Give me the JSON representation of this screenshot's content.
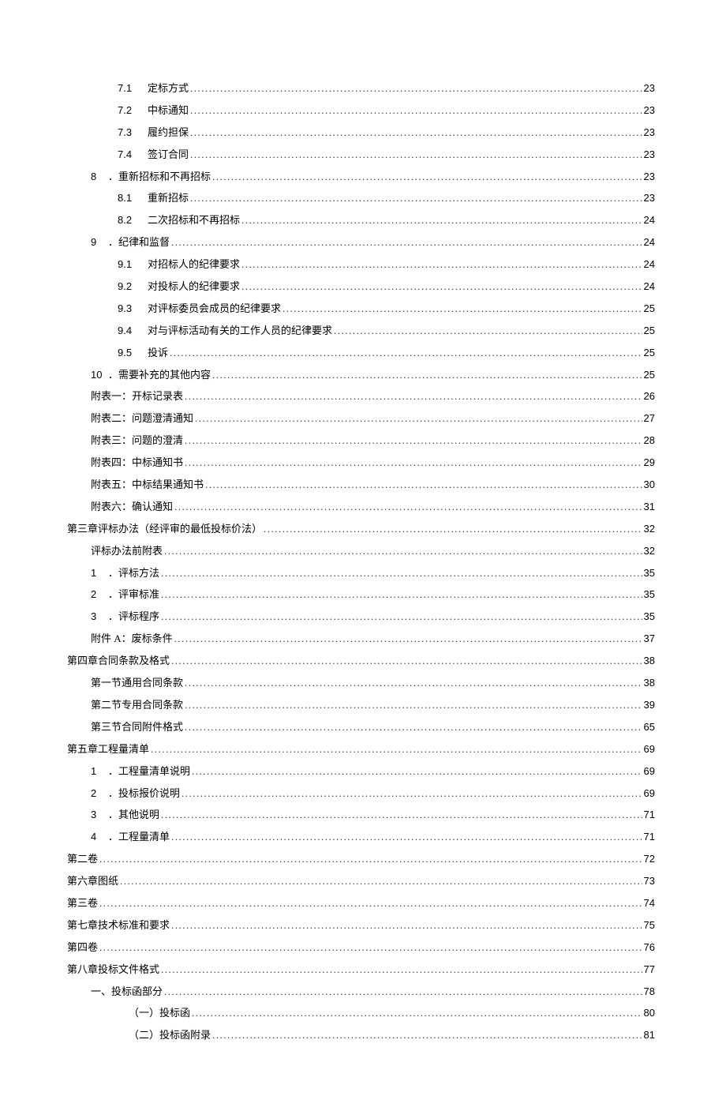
{
  "toc": [
    {
      "indent": "indent-2",
      "num": "7.1",
      "title": "定标方式",
      "page": "23"
    },
    {
      "indent": "indent-2",
      "num": "7.2",
      "title": "中标通知",
      "page": "23"
    },
    {
      "indent": "indent-2",
      "num": "7.3",
      "title": "履约担保",
      "page": "23"
    },
    {
      "indent": "indent-2",
      "num": "7.4",
      "title": "签订合同",
      "page": "23"
    },
    {
      "indent": "indent-1n",
      "num": "8",
      "title": "．重新招标和不再招标 ",
      "page": "23"
    },
    {
      "indent": "indent-2",
      "num": "8.1",
      "title": "重新招标",
      "page": "23"
    },
    {
      "indent": "indent-2",
      "num": "8.2",
      "title": "二次招标和不再招标",
      "page": "24"
    },
    {
      "indent": "indent-1n",
      "num": "9",
      "title": "．纪律和监督 ",
      "page": "24"
    },
    {
      "indent": "indent-2",
      "num": "9.1",
      "title": "对招标人的纪律要求",
      "page": "24"
    },
    {
      "indent": "indent-2",
      "num": "9.2",
      "title": "对投标人的纪律要求",
      "page": "24"
    },
    {
      "indent": "indent-2",
      "num": "9.3",
      "title": "对评标委员会成员的纪律要求",
      "page": "25"
    },
    {
      "indent": "indent-2",
      "num": "9.4",
      "title": "对与评标活动有关的工作人员的纪律要求",
      "page": "25"
    },
    {
      "indent": "indent-2",
      "num": "9.5",
      "title": "投诉",
      "page": "25"
    },
    {
      "indent": "indent-1n",
      "num": "10",
      "title": "．需要补充的其他内容 ",
      "page": "25"
    },
    {
      "indent": "indent-1",
      "num": "",
      "title": "附表一：开标记录表",
      "page": "26"
    },
    {
      "indent": "indent-1",
      "num": "",
      "title": "附表二：问题澄清通知",
      "page": "27"
    },
    {
      "indent": "indent-1",
      "num": "",
      "title": "附表三：问题的澄清",
      "page": "28"
    },
    {
      "indent": "indent-1",
      "num": "",
      "title": "附表四：中标通知书",
      "page": "29"
    },
    {
      "indent": "indent-1",
      "num": "",
      "title": "附表五：中标结果通知书",
      "page": "30"
    },
    {
      "indent": "indent-1",
      "num": "",
      "title": "附表六：确认通知",
      "page": "31"
    },
    {
      "indent": "indent-0",
      "num": "",
      "title": "第三章评标办法（经评审的最低投标价法）",
      "page": "32"
    },
    {
      "indent": "indent-1",
      "num": "",
      "title": "评标办法前附表",
      "page": "32"
    },
    {
      "indent": "indent-1n",
      "num": "1",
      "title": "．评标方法 ",
      "page": "35"
    },
    {
      "indent": "indent-1n",
      "num": "2",
      "title": "．评审标准",
      "page": "35"
    },
    {
      "indent": "indent-1n",
      "num": "3",
      "title": "．评标程序",
      "page": "35"
    },
    {
      "indent": "indent-1",
      "num": "",
      "title": "附件 A：废标条件",
      "page": "37"
    },
    {
      "indent": "indent-0",
      "num": "",
      "title": "第四章合同条款及格式",
      "page": "38"
    },
    {
      "indent": "indent-1",
      "num": "",
      "title": "第一节通用合同条款",
      "page": "38"
    },
    {
      "indent": "indent-1",
      "num": "",
      "title": "第二节专用合同条款",
      "page": "39"
    },
    {
      "indent": "indent-1",
      "num": "",
      "title": "第三节合同附件格式",
      "page": "65"
    },
    {
      "indent": "indent-0",
      "num": "",
      "title": "第五章工程量清单",
      "page": "69"
    },
    {
      "indent": "indent-1n",
      "num": "1",
      "title": "．工程量清单说明 ",
      "page": "69"
    },
    {
      "indent": "indent-1n",
      "num": "2",
      "title": "．投标报价说明 ",
      "page": "69"
    },
    {
      "indent": "indent-1n",
      "num": "3",
      "title": "．其他说明",
      "page": "71"
    },
    {
      "indent": "indent-1n",
      "num": "4",
      "title": "．工程量清单",
      "page": "71"
    },
    {
      "indent": "indent-0",
      "num": "",
      "title": "第二卷",
      "page": "72"
    },
    {
      "indent": "indent-0",
      "num": "",
      "title": "第六章图纸",
      "page": "73"
    },
    {
      "indent": "indent-0",
      "num": "",
      "title": "第三卷",
      "page": "74"
    },
    {
      "indent": "indent-0",
      "num": "",
      "title": "第七章技术标准和要求",
      "page": "75"
    },
    {
      "indent": "indent-0",
      "num": "",
      "title": "第四卷",
      "page": "76"
    },
    {
      "indent": "indent-0",
      "num": "",
      "title": "第八章投标文件格式",
      "page": "77"
    },
    {
      "indent": "indent-1",
      "num": "",
      "title": "一、投标函部分",
      "page": "78"
    },
    {
      "indent": "indent-3",
      "num": "",
      "title": "（一）投标函 ",
      "page": "80"
    },
    {
      "indent": "indent-3",
      "num": "",
      "title": "（二）投标函附录 ",
      "page": "81"
    }
  ]
}
